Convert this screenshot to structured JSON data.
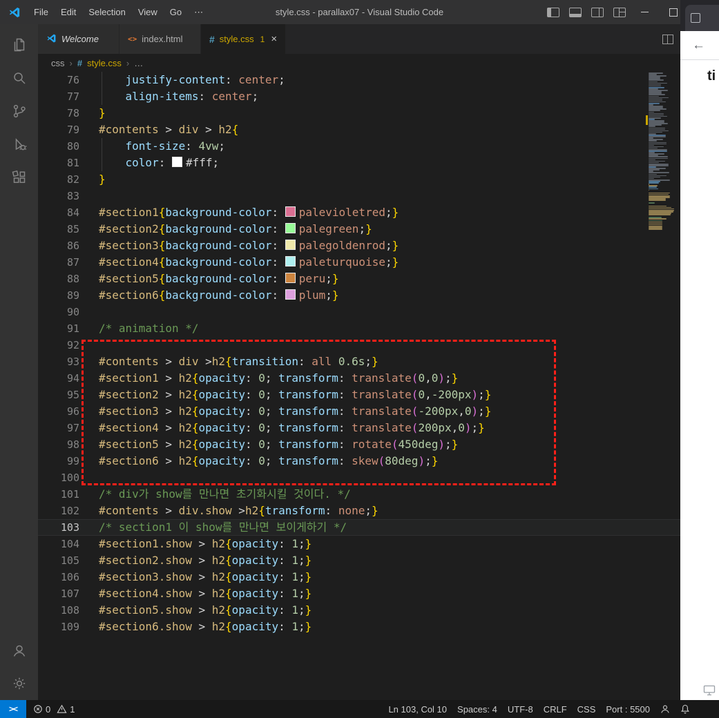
{
  "title_bar": {
    "menus": [
      "File",
      "Edit",
      "Selection",
      "View",
      "Go",
      "⋯"
    ],
    "title": "style.css - parallax07 - Visual Studio Code"
  },
  "tabs": [
    {
      "label": "Welcome",
      "icon": "vscode",
      "italic": true,
      "active": false
    },
    {
      "label": "index.html",
      "icon": "html",
      "italic": false,
      "active": false
    },
    {
      "label": "style.css",
      "icon": "css",
      "italic": false,
      "active": true,
      "badge": "1",
      "close": "×"
    }
  ],
  "breadcrumb": {
    "folder": "css",
    "file_icon": "#",
    "file": "style.css",
    "more": "…",
    "sep": "›"
  },
  "code": {
    "lines": [
      {
        "n": 76,
        "g": 1,
        "tk": [
          [
            "    justify-content",
            "prop"
          ],
          [
            ": ",
            "op"
          ],
          [
            "center",
            "val"
          ],
          [
            ";",
            "op"
          ]
        ]
      },
      {
        "n": 77,
        "g": 1,
        "tk": [
          [
            "    align-items",
            "prop"
          ],
          [
            ": ",
            "op"
          ],
          [
            "center",
            "val"
          ],
          [
            ";",
            "op"
          ]
        ]
      },
      {
        "n": 78,
        "tk": [
          [
            "}",
            "br"
          ]
        ]
      },
      {
        "n": 79,
        "tk": [
          [
            "#contents",
            "sel"
          ],
          [
            " > ",
            "op"
          ],
          [
            "div",
            "sel"
          ],
          [
            " > ",
            "op"
          ],
          [
            "h2",
            "sel"
          ],
          [
            "{",
            "br"
          ]
        ]
      },
      {
        "n": 80,
        "g": 1,
        "tk": [
          [
            "    font-size",
            "prop"
          ],
          [
            ": ",
            "op"
          ],
          [
            "4vw",
            "num"
          ],
          [
            ";",
            "op"
          ]
        ]
      },
      {
        "n": 81,
        "g": 1,
        "tk": [
          [
            "    color",
            "prop"
          ],
          [
            ": ",
            "op"
          ],
          [
            "#ffffff",
            "sw"
          ],
          [
            "#fff",
            "fg"
          ],
          [
            ";",
            "op"
          ]
        ]
      },
      {
        "n": 82,
        "tk": [
          [
            "}",
            "br"
          ]
        ]
      },
      {
        "n": 83,
        "tk": []
      },
      {
        "n": 84,
        "tk": [
          [
            "#section1",
            "sel"
          ],
          [
            "{",
            "br"
          ],
          [
            "background-color",
            "prop"
          ],
          [
            ": ",
            "op"
          ],
          [
            "#db7093",
            "sw"
          ],
          [
            "palevioletred",
            "val"
          ],
          [
            ";",
            "op"
          ],
          [
            "}",
            "br"
          ]
        ]
      },
      {
        "n": 85,
        "tk": [
          [
            "#section2",
            "sel"
          ],
          [
            "{",
            "br"
          ],
          [
            "background-color",
            "prop"
          ],
          [
            ": ",
            "op"
          ],
          [
            "#98fb98",
            "sw"
          ],
          [
            "palegreen",
            "val"
          ],
          [
            ";",
            "op"
          ],
          [
            "}",
            "br"
          ]
        ]
      },
      {
        "n": 86,
        "tk": [
          [
            "#section3",
            "sel"
          ],
          [
            "{",
            "br"
          ],
          [
            "background-color",
            "prop"
          ],
          [
            ": ",
            "op"
          ],
          [
            "#eee8aa",
            "sw"
          ],
          [
            "palegoldenrod",
            "val"
          ],
          [
            ";",
            "op"
          ],
          [
            "}",
            "br"
          ]
        ]
      },
      {
        "n": 87,
        "tk": [
          [
            "#section4",
            "sel"
          ],
          [
            "{",
            "br"
          ],
          [
            "background-color",
            "prop"
          ],
          [
            ": ",
            "op"
          ],
          [
            "#afeeee",
            "sw"
          ],
          [
            "paleturquoise",
            "val"
          ],
          [
            ";",
            "op"
          ],
          [
            "}",
            "br"
          ]
        ]
      },
      {
        "n": 88,
        "tk": [
          [
            "#section5",
            "sel"
          ],
          [
            "{",
            "br"
          ],
          [
            "background-color",
            "prop"
          ],
          [
            ": ",
            "op"
          ],
          [
            "#cd853f",
            "sw"
          ],
          [
            "peru",
            "val"
          ],
          [
            ";",
            "op"
          ],
          [
            "}",
            "br"
          ]
        ]
      },
      {
        "n": 89,
        "tk": [
          [
            "#section6",
            "sel"
          ],
          [
            "{",
            "br"
          ],
          [
            "background-color",
            "prop"
          ],
          [
            ": ",
            "op"
          ],
          [
            "#dda0dd",
            "sw"
          ],
          [
            "plum",
            "val"
          ],
          [
            ";",
            "op"
          ],
          [
            "}",
            "br"
          ]
        ]
      },
      {
        "n": 90,
        "tk": []
      },
      {
        "n": 91,
        "tk": [
          [
            "/* animation */",
            "com"
          ]
        ]
      },
      {
        "n": 92,
        "tk": []
      },
      {
        "n": 93,
        "tk": [
          [
            "#contents",
            "sel"
          ],
          [
            " > ",
            "op"
          ],
          [
            "div",
            "sel"
          ],
          [
            " >",
            "op"
          ],
          [
            "h2",
            "sel"
          ],
          [
            "{",
            "br"
          ],
          [
            "transition",
            "prop"
          ],
          [
            ": ",
            "op"
          ],
          [
            "all",
            "val"
          ],
          [
            " ",
            "op"
          ],
          [
            "0.6s",
            "num"
          ],
          [
            ";",
            "op"
          ],
          [
            "}",
            "br"
          ]
        ]
      },
      {
        "n": 94,
        "tk": [
          [
            "#section1",
            "sel"
          ],
          [
            " > ",
            "op"
          ],
          [
            "h2",
            "sel"
          ],
          [
            "{",
            "br"
          ],
          [
            "opacity",
            "prop"
          ],
          [
            ": ",
            "op"
          ],
          [
            "0",
            "num"
          ],
          [
            "; ",
            "op"
          ],
          [
            "transform",
            "prop"
          ],
          [
            ": ",
            "op"
          ],
          [
            "translate",
            "val"
          ],
          [
            "(",
            "pn"
          ],
          [
            "0",
            "num"
          ],
          [
            ",",
            "op"
          ],
          [
            "0",
            "num"
          ],
          [
            ")",
            "pn"
          ],
          [
            ";",
            "op"
          ],
          [
            "}",
            "br"
          ]
        ]
      },
      {
        "n": 95,
        "tk": [
          [
            "#section2",
            "sel"
          ],
          [
            " > ",
            "op"
          ],
          [
            "h2",
            "sel"
          ],
          [
            "{",
            "br"
          ],
          [
            "opacity",
            "prop"
          ],
          [
            ": ",
            "op"
          ],
          [
            "0",
            "num"
          ],
          [
            "; ",
            "op"
          ],
          [
            "transform",
            "prop"
          ],
          [
            ": ",
            "op"
          ],
          [
            "translate",
            "val"
          ],
          [
            "(",
            "pn"
          ],
          [
            "0",
            "num"
          ],
          [
            ",",
            "op"
          ],
          [
            "-200px",
            "num"
          ],
          [
            ")",
            "pn"
          ],
          [
            ";",
            "op"
          ],
          [
            "}",
            "br"
          ]
        ]
      },
      {
        "n": 96,
        "tk": [
          [
            "#section3",
            "sel"
          ],
          [
            " > ",
            "op"
          ],
          [
            "h2",
            "sel"
          ],
          [
            "{",
            "br"
          ],
          [
            "opacity",
            "prop"
          ],
          [
            ": ",
            "op"
          ],
          [
            "0",
            "num"
          ],
          [
            "; ",
            "op"
          ],
          [
            "transform",
            "prop"
          ],
          [
            ": ",
            "op"
          ],
          [
            "translate",
            "val"
          ],
          [
            "(",
            "pn"
          ],
          [
            "-200px",
            "num"
          ],
          [
            ",",
            "op"
          ],
          [
            "0",
            "num"
          ],
          [
            ")",
            "pn"
          ],
          [
            ";",
            "op"
          ],
          [
            "}",
            "br"
          ]
        ]
      },
      {
        "n": 97,
        "tk": [
          [
            "#section4",
            "sel"
          ],
          [
            " > ",
            "op"
          ],
          [
            "h2",
            "sel"
          ],
          [
            "{",
            "br"
          ],
          [
            "opacity",
            "prop"
          ],
          [
            ": ",
            "op"
          ],
          [
            "0",
            "num"
          ],
          [
            "; ",
            "op"
          ],
          [
            "transform",
            "prop"
          ],
          [
            ": ",
            "op"
          ],
          [
            "translate",
            "val"
          ],
          [
            "(",
            "pn"
          ],
          [
            "200px",
            "num"
          ],
          [
            ",",
            "op"
          ],
          [
            "0",
            "num"
          ],
          [
            ")",
            "pn"
          ],
          [
            ";",
            "op"
          ],
          [
            "}",
            "br"
          ]
        ]
      },
      {
        "n": 98,
        "tk": [
          [
            "#section5",
            "sel"
          ],
          [
            " > ",
            "op"
          ],
          [
            "h2",
            "sel"
          ],
          [
            "{",
            "br"
          ],
          [
            "opacity",
            "prop"
          ],
          [
            ": ",
            "op"
          ],
          [
            "0",
            "num"
          ],
          [
            "; ",
            "op"
          ],
          [
            "transform",
            "prop"
          ],
          [
            ": ",
            "op"
          ],
          [
            "rotate",
            "val"
          ],
          [
            "(",
            "pn"
          ],
          [
            "450deg",
            "num"
          ],
          [
            ")",
            "pn"
          ],
          [
            ";",
            "op"
          ],
          [
            "}",
            "br"
          ]
        ]
      },
      {
        "n": 99,
        "tk": [
          [
            "#section6",
            "sel"
          ],
          [
            " > ",
            "op"
          ],
          [
            "h2",
            "sel"
          ],
          [
            "{",
            "br"
          ],
          [
            "opacity",
            "prop"
          ],
          [
            ": ",
            "op"
          ],
          [
            "0",
            "num"
          ],
          [
            "; ",
            "op"
          ],
          [
            "transform",
            "prop"
          ],
          [
            ": ",
            "op"
          ],
          [
            "skew",
            "val"
          ],
          [
            "(",
            "pn"
          ],
          [
            "80deg",
            "num"
          ],
          [
            ")",
            "pn"
          ],
          [
            ";",
            "op"
          ],
          [
            "}",
            "br"
          ]
        ]
      },
      {
        "n": 100,
        "tk": []
      },
      {
        "n": 101,
        "tk": [
          [
            "/* div가 show를 만나면 초기화시킬 것이다. */",
            "com"
          ]
        ]
      },
      {
        "n": 102,
        "tk": [
          [
            "#contents",
            "sel"
          ],
          [
            " > ",
            "op"
          ],
          [
            "div.show",
            "sel"
          ],
          [
            " >",
            "op"
          ],
          [
            "h2",
            "sel"
          ],
          [
            "{",
            "br"
          ],
          [
            "transform",
            "prop"
          ],
          [
            ": ",
            "op"
          ],
          [
            "none",
            "val"
          ],
          [
            ";",
            "op"
          ],
          [
            "}",
            "br"
          ]
        ]
      },
      {
        "n": 103,
        "cur": 1,
        "tk": [
          [
            "/* section1 이 show를 만나면 보이게하기 */",
            "com"
          ]
        ]
      },
      {
        "n": 104,
        "tk": [
          [
            "#section1.show",
            "sel"
          ],
          [
            " > ",
            "op"
          ],
          [
            "h2",
            "sel"
          ],
          [
            "{",
            "br"
          ],
          [
            "opacity",
            "prop"
          ],
          [
            ": ",
            "op"
          ],
          [
            "1",
            "num"
          ],
          [
            ";",
            "op"
          ],
          [
            "}",
            "br"
          ]
        ]
      },
      {
        "n": 105,
        "tk": [
          [
            "#section2.show",
            "sel"
          ],
          [
            " > ",
            "op"
          ],
          [
            "h2",
            "sel"
          ],
          [
            "{",
            "br"
          ],
          [
            "opacity",
            "prop"
          ],
          [
            ": ",
            "op"
          ],
          [
            "1",
            "num"
          ],
          [
            ";",
            "op"
          ],
          [
            "}",
            "br"
          ]
        ]
      },
      {
        "n": 106,
        "tk": [
          [
            "#section3.show",
            "sel"
          ],
          [
            " > ",
            "op"
          ],
          [
            "h2",
            "sel"
          ],
          [
            "{",
            "br"
          ],
          [
            "opacity",
            "prop"
          ],
          [
            ": ",
            "op"
          ],
          [
            "1",
            "num"
          ],
          [
            ";",
            "op"
          ],
          [
            "}",
            "br"
          ]
        ]
      },
      {
        "n": 107,
        "tk": [
          [
            "#section4.show",
            "sel"
          ],
          [
            " > ",
            "op"
          ],
          [
            "h2",
            "sel"
          ],
          [
            "{",
            "br"
          ],
          [
            "opacity",
            "prop"
          ],
          [
            ": ",
            "op"
          ],
          [
            "1",
            "num"
          ],
          [
            ";",
            "op"
          ],
          [
            "}",
            "br"
          ]
        ]
      },
      {
        "n": 108,
        "tk": [
          [
            "#section5.show",
            "sel"
          ],
          [
            " > ",
            "op"
          ],
          [
            "h2",
            "sel"
          ],
          [
            "{",
            "br"
          ],
          [
            "opacity",
            "prop"
          ],
          [
            ": ",
            "op"
          ],
          [
            "1",
            "num"
          ],
          [
            ";",
            "op"
          ],
          [
            "}",
            "br"
          ]
        ]
      },
      {
        "n": 109,
        "tk": [
          [
            "#section6.show",
            "sel"
          ],
          [
            " > ",
            "op"
          ],
          [
            "h2",
            "sel"
          ],
          [
            "{",
            "br"
          ],
          [
            "opacity",
            "prop"
          ],
          [
            ": ",
            "op"
          ],
          [
            "1",
            "num"
          ],
          [
            ";",
            "op"
          ],
          [
            "}",
            "br"
          ]
        ]
      }
    ]
  },
  "annotation": {
    "border_color": "#ff2019",
    "covers_lines": "93-99"
  },
  "browser": {
    "back": "←",
    "heading": "ti"
  },
  "status_bar": {
    "remote": "><",
    "errors": "0",
    "warnings": "1",
    "right": [
      "Ln 103, Col 10",
      "Spaces: 4",
      "UTF-8",
      "CRLF",
      "CSS",
      "Port : 5500"
    ]
  },
  "colors": {
    "accent_remote": "#0078d4",
    "warning": "#cca700",
    "annotation_red": "#ff2019"
  }
}
